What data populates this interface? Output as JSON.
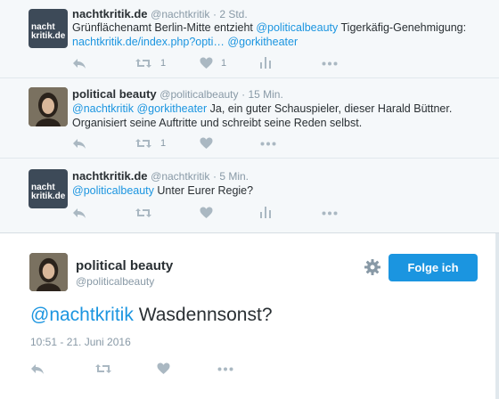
{
  "tweets": [
    {
      "name": "nachtkritik.de",
      "handle": "@nachtkritik",
      "time": "· 2 Std.",
      "avatar_text": [
        "nacht",
        "kritik.de"
      ],
      "line1_text": "Grünflächenamt Berlin-Mitte entzieht ",
      "line1_link": "@politicalbeauty",
      "line1_rest": " Tigerkäfig-Genehmigung:",
      "line2_link1": "nachtkritik.de/index.php?opti…",
      "line2_link2": "@gorkitheater",
      "retweet_count": "1",
      "like_count": "1"
    },
    {
      "name": "political beauty",
      "handle": "@politicalbeauty",
      "time": "· 15 Min.",
      "line1_link1": "@nachtkritik",
      "line1_link2": "@gorkitheater",
      "line1_rest": " Ja, ein guter Schauspieler, dieser Harald Büttner.",
      "line2_text": "Organisiert seine Auftritte und schreibt seine Reden selbst.",
      "retweet_count": "1"
    },
    {
      "name": "nachtkritik.de",
      "handle": "@nachtkritik",
      "time": "· 5 Min.",
      "avatar_text": [
        "nacht",
        "kritik.de"
      ],
      "line1_link": "@politicalbeauty",
      "line1_rest": " Unter Eurer Regie?"
    }
  ],
  "focus": {
    "name": "political beauty",
    "handle": "@politicalbeauty",
    "follow_label": "Folge ich",
    "mention": "@nachtkritik",
    "text": " Wasdennsonst?",
    "timestamp": "10:51 - 21. Juni 2016"
  },
  "colors": {
    "link": "#1b95e0",
    "icon": "#aab8c2",
    "follow_bg": "#1b95e0"
  },
  "icons": [
    "reply-icon",
    "retweet-icon",
    "like-icon",
    "analytics-icon",
    "more-icon",
    "gear-icon"
  ]
}
